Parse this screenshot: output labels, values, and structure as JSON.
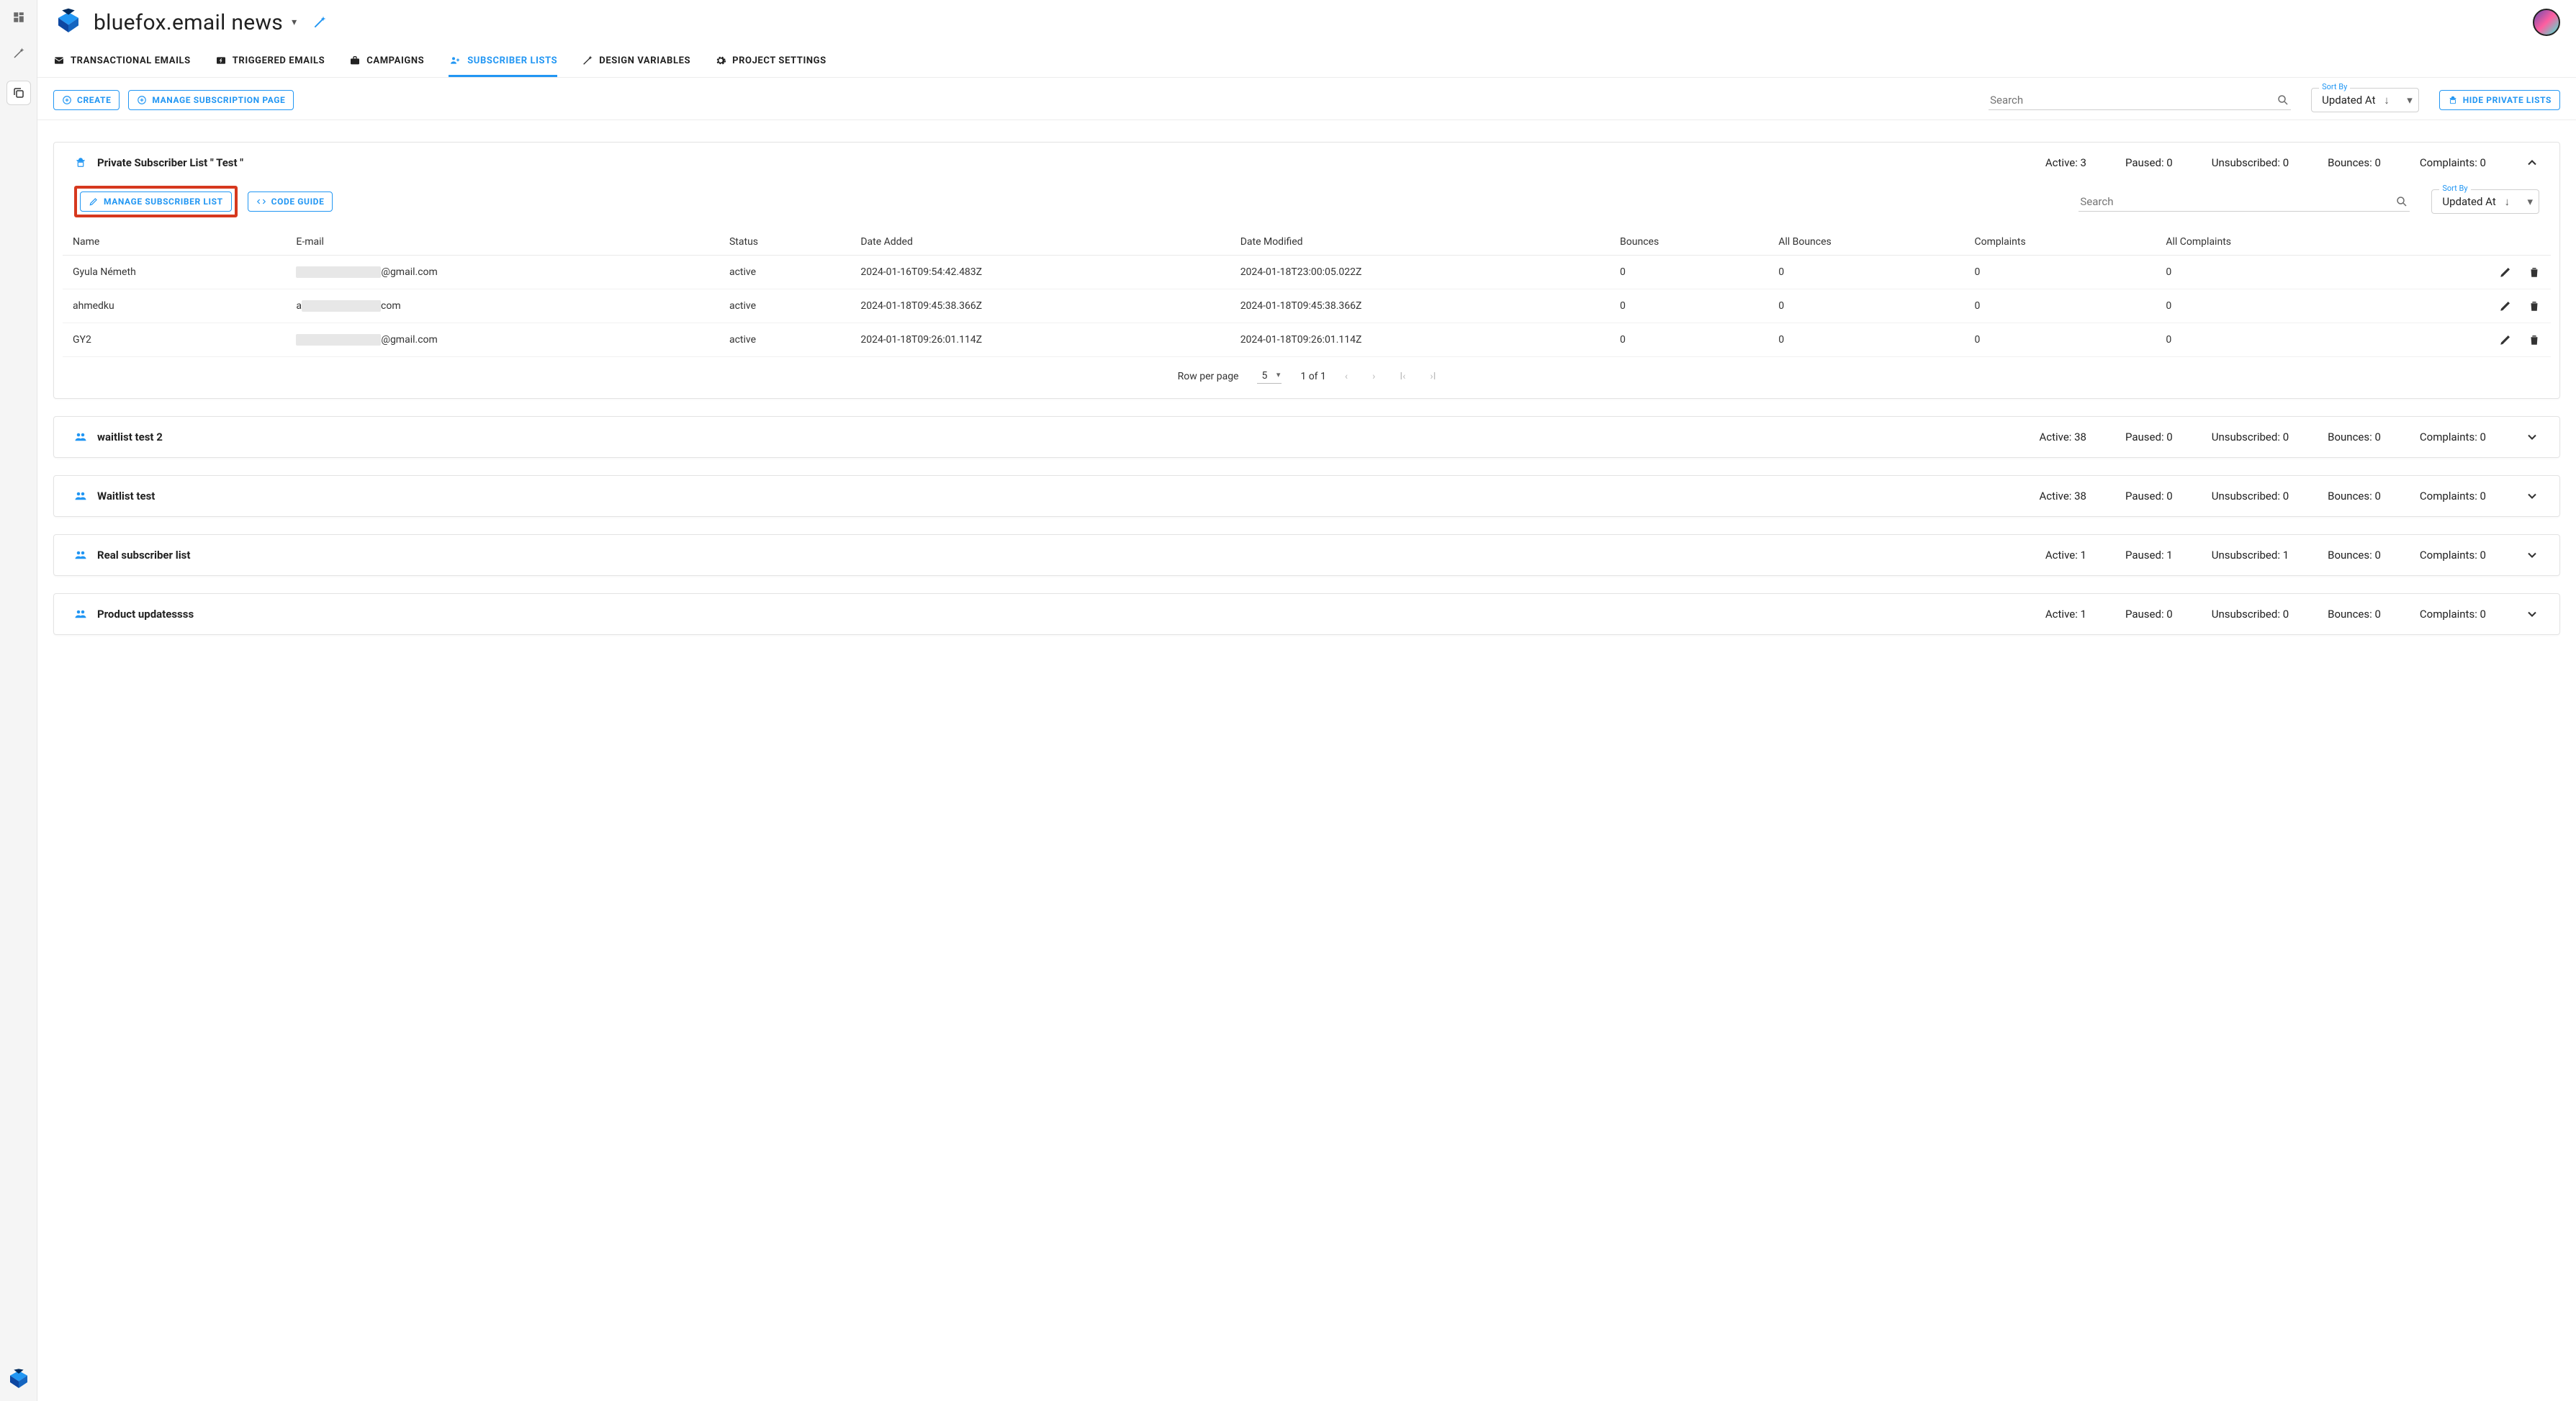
{
  "header": {
    "project_name": "bluefox.email news"
  },
  "tabs": [
    {
      "icon": "mail",
      "label": "TRANSACTIONAL EMAILS"
    },
    {
      "icon": "bolt",
      "label": "TRIGGERED EMAILS"
    },
    {
      "icon": "briefcase",
      "label": "CAMPAIGNS"
    },
    {
      "icon": "people-plus",
      "label": "SUBSCRIBER LISTS",
      "active": true
    },
    {
      "icon": "wand",
      "label": "DESIGN VARIABLES"
    },
    {
      "icon": "gear",
      "label": "PROJECT SETTINGS"
    }
  ],
  "toolbar": {
    "create_label": "CREATE",
    "manage_page_label": "MANAGE SUBSCRIPTION PAGE",
    "search_placeholder": "Search",
    "sort_label": "Sort By",
    "sort_value": "Updated At",
    "hide_private_label": "HIDE PRIVATE LISTS"
  },
  "expanded_list": {
    "title": "Private Subscriber List \" Test \"",
    "stats": {
      "active": "Active: 3",
      "paused": "Paused: 0",
      "unsub": "Unsubscribed: 0",
      "bounces": "Bounces: 0",
      "complaints": "Complaints: 0"
    },
    "manage_btn": "MANAGE SUBSCRIBER LIST",
    "code_btn": "CODE GUIDE",
    "search_placeholder": "Search",
    "sort_label": "Sort By",
    "sort_value": "Updated At",
    "columns": {
      "name": "Name",
      "email": "E-mail",
      "status": "Status",
      "added": "Date Added",
      "modified": "Date Modified",
      "bounces": "Bounces",
      "all_bounces": "All Bounces",
      "complaints": "Complaints",
      "all_complaints": "All Complaints"
    },
    "rows": [
      {
        "name": "Gyula Németh",
        "email_prefix": "",
        "email_suffix": "@gmail.com",
        "mask_w": 118,
        "status": "active",
        "added": "2024-01-16T09:54:42.483Z",
        "modified": "2024-01-18T23:00:05.022Z",
        "bounces": "0",
        "all_bounces": "0",
        "complaints": "0",
        "all_complaints": "0"
      },
      {
        "name": "ahmedku",
        "email_prefix": "a",
        "email_suffix": "com",
        "mask_w": 110,
        "status": "active",
        "added": "2024-01-18T09:45:38.366Z",
        "modified": "2024-01-18T09:45:38.366Z",
        "bounces": "0",
        "all_bounces": "0",
        "complaints": "0",
        "all_complaints": "0"
      },
      {
        "name": "GY2",
        "email_prefix": "",
        "email_suffix": "@gmail.com",
        "mask_w": 118,
        "status": "active",
        "added": "2024-01-18T09:26:01.114Z",
        "modified": "2024-01-18T09:26:01.114Z",
        "bounces": "0",
        "all_bounces": "0",
        "complaints": "0",
        "all_complaints": "0"
      }
    ],
    "pager": {
      "rpp_label": "Row per page",
      "rpp_value": "5",
      "range": "1 of 1"
    }
  },
  "collapsed_lists": [
    {
      "title": "waitlist test 2",
      "active": "Active: 38",
      "paused": "Paused: 0",
      "unsub": "Unsubscribed: 0",
      "bounces": "Bounces: 0",
      "complaints": "Complaints: 0"
    },
    {
      "title": "Waitlist test",
      "active": "Active: 38",
      "paused": "Paused: 0",
      "unsub": "Unsubscribed: 0",
      "bounces": "Bounces: 0",
      "complaints": "Complaints: 0"
    },
    {
      "title": "Real subscriber list",
      "active": "Active: 1",
      "paused": "Paused: 1",
      "unsub": "Unsubscribed: 1",
      "bounces": "Bounces: 0",
      "complaints": "Complaints: 0"
    },
    {
      "title": "Product updatessss",
      "active": "Active: 1",
      "paused": "Paused: 0",
      "unsub": "Unsubscribed: 0",
      "bounces": "Bounces: 0",
      "complaints": "Complaints: 0"
    }
  ]
}
